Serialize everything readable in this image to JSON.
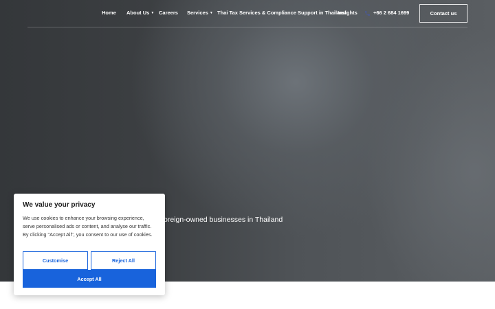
{
  "nav": {
    "items": [
      {
        "label": "Home",
        "dropdown": false
      },
      {
        "label": "About Us",
        "dropdown": true
      },
      {
        "label": "Careers",
        "dropdown": false
      },
      {
        "label": "Services",
        "dropdown": true
      },
      {
        "label": "Thai Tax Services & Compliance Support in Thailand",
        "dropdown": false
      },
      {
        "label": "Insights",
        "dropdown": false
      }
    ],
    "phone": "+66 2 684 1699",
    "phone_icon": "phone-icon",
    "contact_label": "Contact us"
  },
  "hero": {
    "subtitle_visible": "oreign-owned businesses in Thailand"
  },
  "cookie_banner": {
    "title": "We value your privacy",
    "text": "We use cookies to enhance your browsing experience, serve personalised ads or content, and analyse our traffic. By clicking \"Accept All\", you consent to our use of cookies.",
    "customise_label": "Customise",
    "reject_label": "Reject All",
    "accept_label": "Accept All",
    "accent_color": "#1863dc"
  }
}
